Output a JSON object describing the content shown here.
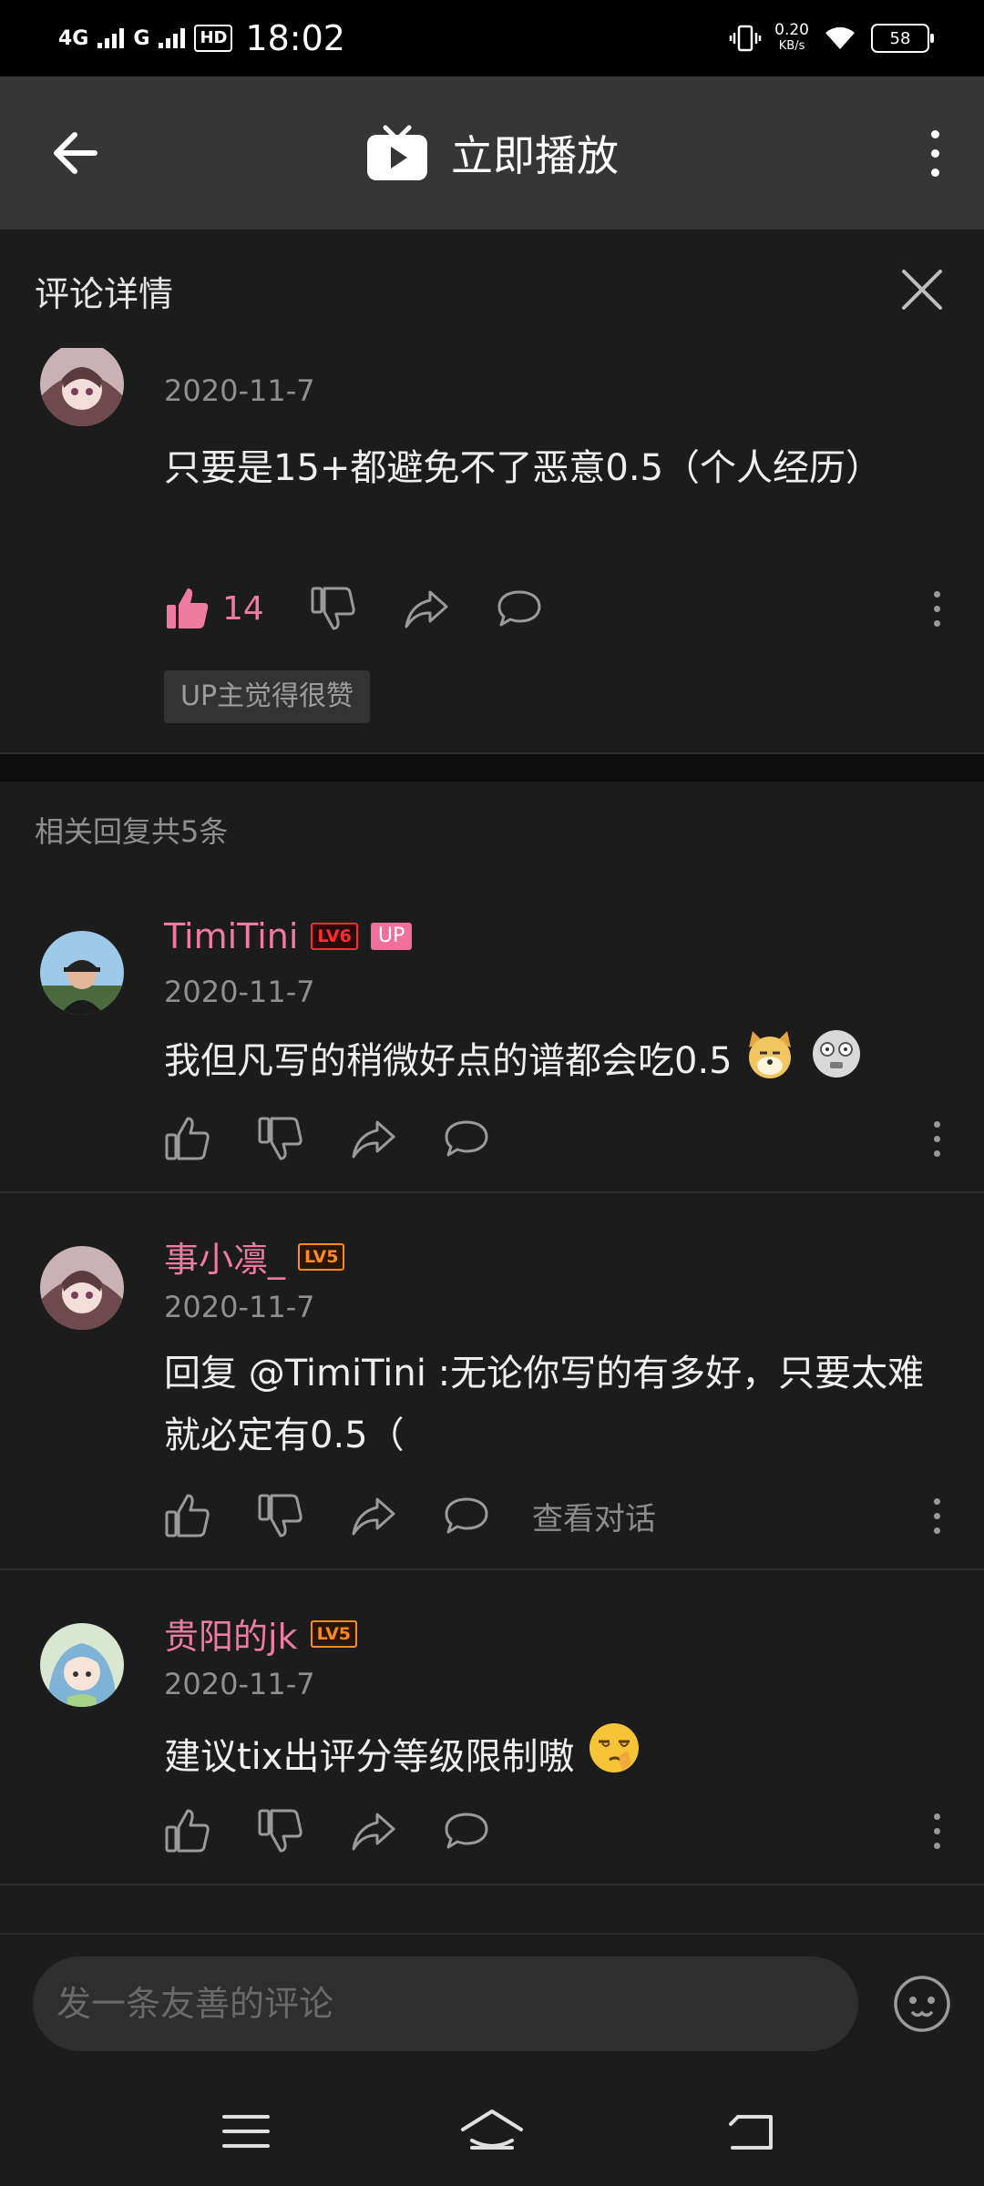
{
  "status_bar": {
    "network_1": "4G",
    "network_2": "G",
    "hd": "HD",
    "time": "18:02",
    "speed": "0.20",
    "speed_unit": "KB/s",
    "battery": "58"
  },
  "top_bar": {
    "title": "立即播放"
  },
  "panel": {
    "title": "评论详情"
  },
  "main_comment": {
    "date": "2020-11-7",
    "text": "只要是15+都避免不了恶意0.5（个人经历）",
    "likes": "14",
    "up_liked_label": "UP主觉得很赞"
  },
  "replies_header": "相关回复共5条",
  "replies": [
    {
      "username": "TimiTini",
      "level": "LV6",
      "badge": "UP",
      "date": "2020-11-7",
      "text": "我但凡写的稍微好点的谱都会吃0.5"
    },
    {
      "username": "事小凛_",
      "level": "LV5",
      "date": "2020-11-7",
      "text": "回复 @TimiTini :无论你写的有多好，只要太难就必定有0.5（",
      "view_conversation": "查看对话"
    },
    {
      "username": "贵阳的jk",
      "level": "LV5",
      "date": "2020-11-7",
      "text": "建议tix出评分等级限制嗷"
    }
  ],
  "input": {
    "placeholder": "发一条友善的评论"
  },
  "colors": {
    "accent_pink": "#f07ba0",
    "lv6": "#ff2e2e",
    "lv5": "#ff8a1e",
    "background": "#1c1c1c",
    "top_bar": "#363636"
  }
}
